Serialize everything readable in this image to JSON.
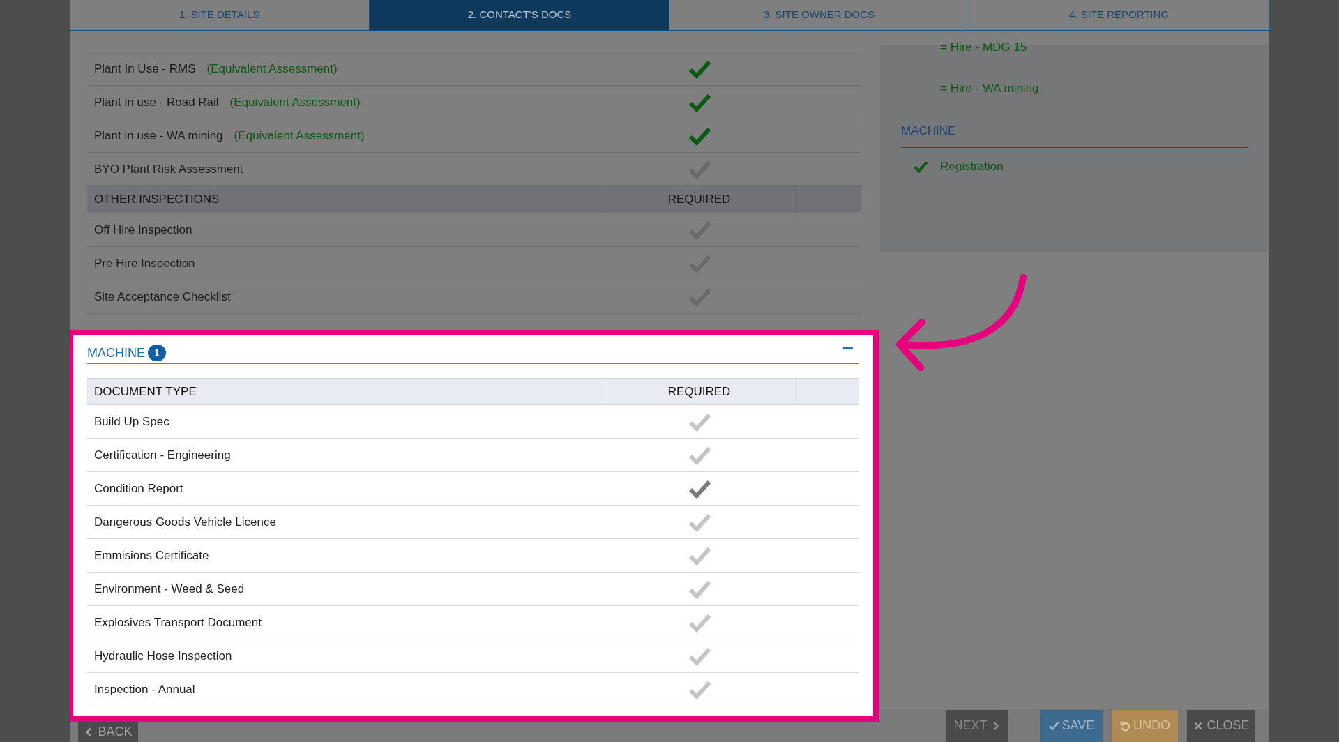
{
  "tabs": [
    {
      "label": "1. SITE DETAILS",
      "selected": false
    },
    {
      "label": "2. CONTACT'S DOCS",
      "selected": true
    },
    {
      "label": "3. SITE OWNER DOCS",
      "selected": false
    },
    {
      "label": "4. SITE REPORTING",
      "selected": false
    }
  ],
  "plant_table": {
    "rows": [
      {
        "kind": "row",
        "label": "Plant In Use - RMS",
        "note": "(Equivalent Assessment)",
        "equivalent": true
      },
      {
        "kind": "row",
        "label": "Plant in use - Road Rail",
        "note": "(Equivalent Assessment)",
        "equivalent": true
      },
      {
        "kind": "row",
        "label": "Plant in use - WA mining",
        "note": "(Equivalent Assessment)",
        "equivalent": true
      },
      {
        "kind": "row",
        "label": "BYO Plant Risk Assessment",
        "equivalent": false
      },
      {
        "kind": "header",
        "label": "OTHER INSPECTIONS",
        "column_2": "REQUIRED"
      },
      {
        "kind": "row",
        "label": "Off Hire Inspection",
        "equivalent": false
      },
      {
        "kind": "row",
        "label": "Pre Hire Inspection",
        "equivalent": false
      },
      {
        "kind": "row",
        "label": "Site Acceptance Checklist",
        "equivalent": false
      }
    ]
  },
  "summary_panel": {
    "items": [
      {
        "kind": "item",
        "text": "= Hire - MDG 15",
        "checked": false
      },
      {
        "kind": "item",
        "text": "= Hire - WA mining",
        "checked": false
      },
      {
        "kind": "heading",
        "text": "MACHINE"
      },
      {
        "kind": "item",
        "text": "Registration",
        "checked": true
      }
    ]
  },
  "machine_section": {
    "title": "MACHINE",
    "count": "1",
    "collapse": "−",
    "columns": [
      "DOCUMENT TYPE",
      "REQUIRED"
    ],
    "rows": [
      {
        "label": "Build Up Spec",
        "required": false
      },
      {
        "label": "Certification - Engineering",
        "required": false
      },
      {
        "label": "Condition Report",
        "required": true
      },
      {
        "label": "Dangerous Goods Vehicle Licence",
        "required": false
      },
      {
        "label": "Emmisions Certificate",
        "required": false
      },
      {
        "label": "Environment - Weed & Seed",
        "required": false
      },
      {
        "label": "Explosives Transport Document",
        "required": false
      },
      {
        "label": "Hydraulic Hose Inspection",
        "required": false
      },
      {
        "label": "Inspection - Annual",
        "required": false
      }
    ]
  },
  "footer": {
    "buttons": [
      {
        "kind": "back",
        "label": "BACK"
      },
      {
        "kind": "next",
        "label": "NEXT"
      },
      {
        "kind": "save",
        "label": "SAVE"
      },
      {
        "kind": "undo",
        "label": "UNDO"
      },
      {
        "kind": "close",
        "label": "CLOSE"
      }
    ]
  }
}
